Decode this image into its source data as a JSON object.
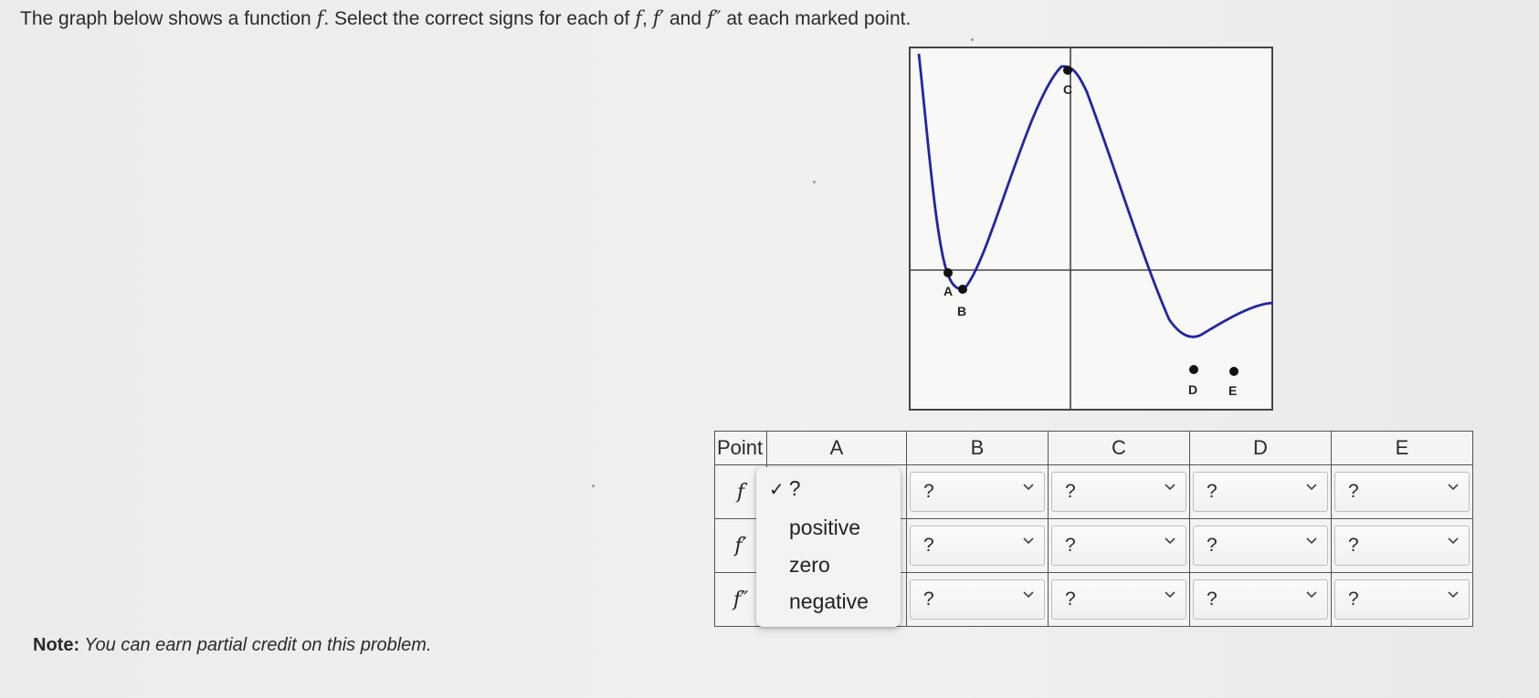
{
  "question": {
    "part1": "The graph below shows a function ",
    "f": "f",
    "part2": ". Select the correct signs for each of ",
    "f2": "f",
    "comma": ",",
    "fprime": "f′",
    "and": " and ",
    "fdouble": "f″",
    "part3": " at each marked point."
  },
  "graph": {
    "curve_color": "#2323a8",
    "points": [
      {
        "label": "A"
      },
      {
        "label": "B"
      },
      {
        "label": "C"
      },
      {
        "label": "D"
      },
      {
        "label": "E"
      }
    ]
  },
  "table": {
    "header_point": "Point",
    "columns": [
      "A",
      "B",
      "C",
      "D",
      "E"
    ],
    "rows": [
      {
        "label": "f",
        "values": [
          "?",
          "?",
          "?",
          "?",
          "?"
        ]
      },
      {
        "label": "f′",
        "values": [
          "?",
          "?",
          "?",
          "?",
          "?"
        ]
      },
      {
        "label": "f″",
        "values": [
          "?",
          "?",
          "?",
          "?",
          "?"
        ]
      }
    ]
  },
  "dropdown": {
    "options": [
      "?",
      "positive",
      "zero",
      "negative"
    ],
    "selected": "?",
    "check_icon": "✓"
  },
  "note": {
    "label": "Note:",
    "text": " You can earn partial credit on this problem."
  }
}
